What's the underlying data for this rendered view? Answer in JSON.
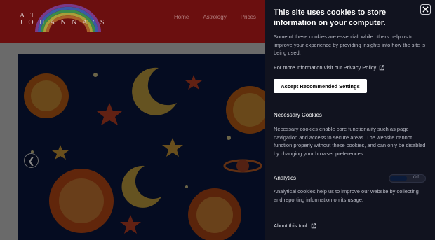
{
  "site": {
    "logo_text_line1": "A T",
    "logo_text_line2": "J O H A N N A ' S",
    "nav": [
      "Home",
      "Astrology",
      "Prices"
    ],
    "prev_arrow": "❮"
  },
  "cookie_panel": {
    "title": "This site uses cookies to store information on your computer.",
    "intro": "Some of these cookies are essential, while others help us to improve your experience by providing insights into how the site is being used.",
    "privacy_text": "For more information visit our Privacy Policy",
    "accept_label": "Accept Recommended Settings",
    "necessary_title": "Necessary Cookies",
    "necessary_text": "Necessary cookies enable core functionality such as page navigation and access to secure areas. The website cannot function properly without these cookies, and can only be disabled by changing your browser preferences.",
    "analytics_title": "Analytics",
    "analytics_toggle_label": "Off",
    "analytics_text": "Analytical cookies help us to improve our website by collecting and reporting information on its usage.",
    "about_label": "About this tool"
  },
  "icons": [
    "close-icon",
    "external-link-icon",
    "rainbow-logo",
    "chevron-left-icon"
  ],
  "colors": {
    "header": "#6b0f0f",
    "panel_bg": "#11131f",
    "accept_bg": "#ffffff"
  }
}
